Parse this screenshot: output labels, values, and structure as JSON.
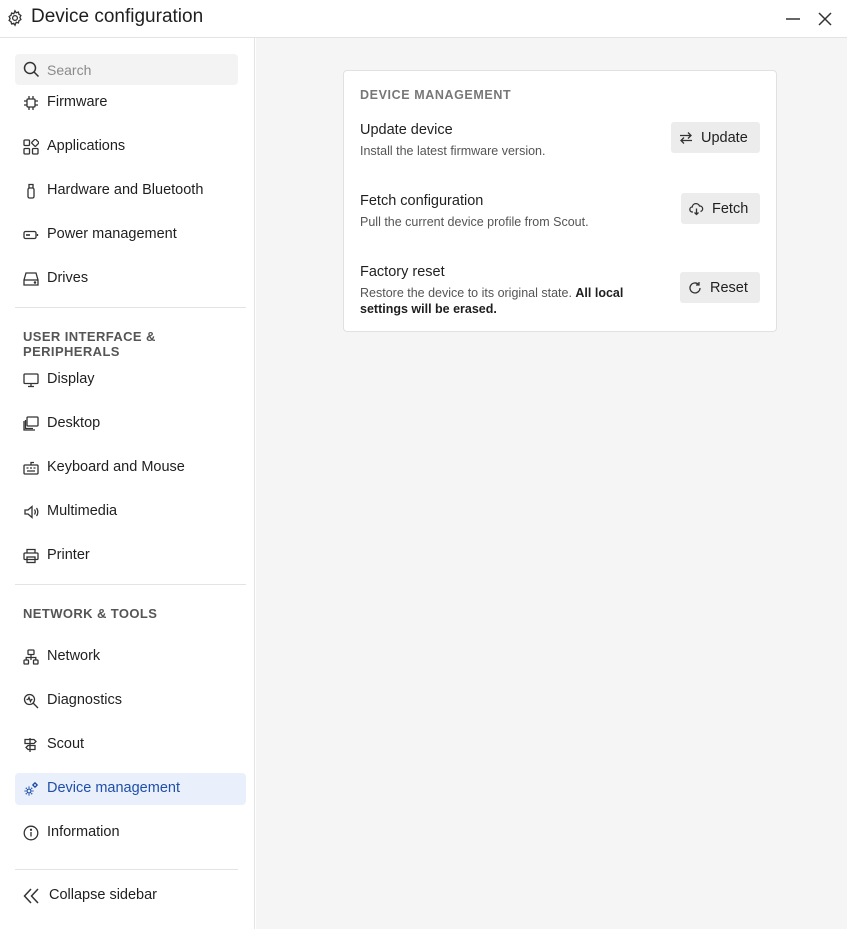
{
  "window": {
    "title": "Device configuration"
  },
  "search": {
    "placeholder": "Search"
  },
  "sidebar": {
    "items": [
      {
        "label": "Firmware",
        "icon": "chip-icon"
      },
      {
        "label": "Applications",
        "icon": "apps-grid-icon"
      },
      {
        "label": "Hardware and Bluetooth",
        "icon": "usb-icon"
      },
      {
        "label": "Power management",
        "icon": "battery-icon"
      },
      {
        "label": "Drives",
        "icon": "drive-icon"
      }
    ],
    "section_ui": "USER INTERFACE & PERIPHERALS",
    "ui_items": [
      {
        "label": "Display",
        "icon": "monitor-icon"
      },
      {
        "label": "Desktop",
        "icon": "desktop-icon"
      },
      {
        "label": "Keyboard and Mouse",
        "icon": "keyboard-icon"
      },
      {
        "label": "Multimedia",
        "icon": "speaker-icon"
      },
      {
        "label": "Printer",
        "icon": "printer-icon"
      }
    ],
    "section_network": "NETWORK & TOOLS",
    "network_items": [
      {
        "label": "Network",
        "icon": "network-icon"
      },
      {
        "label": "Diagnostics",
        "icon": "diagnostics-icon"
      },
      {
        "label": "Scout",
        "icon": "signpost-icon"
      },
      {
        "label": "Device management",
        "icon": "gears-icon",
        "active": true
      },
      {
        "label": "Information",
        "icon": "info-icon"
      }
    ],
    "collapse_label": "Collapse sidebar"
  },
  "main": {
    "card_header": "DEVICE MANAGEMENT",
    "rows": [
      {
        "title": "Update device",
        "description": "Install the latest firmware version.",
        "button": "Update"
      },
      {
        "title": "Fetch configuration",
        "description": "Pull the current device profile from Scout.",
        "button": "Fetch"
      },
      {
        "title": "Factory reset",
        "description": "Restore the device to its original state.",
        "description_bold": "All local settings will be erased.",
        "button": "Reset"
      }
    ]
  },
  "colors": {
    "accent": "#1f4fa8",
    "active_bg": "#eaf0fb"
  }
}
